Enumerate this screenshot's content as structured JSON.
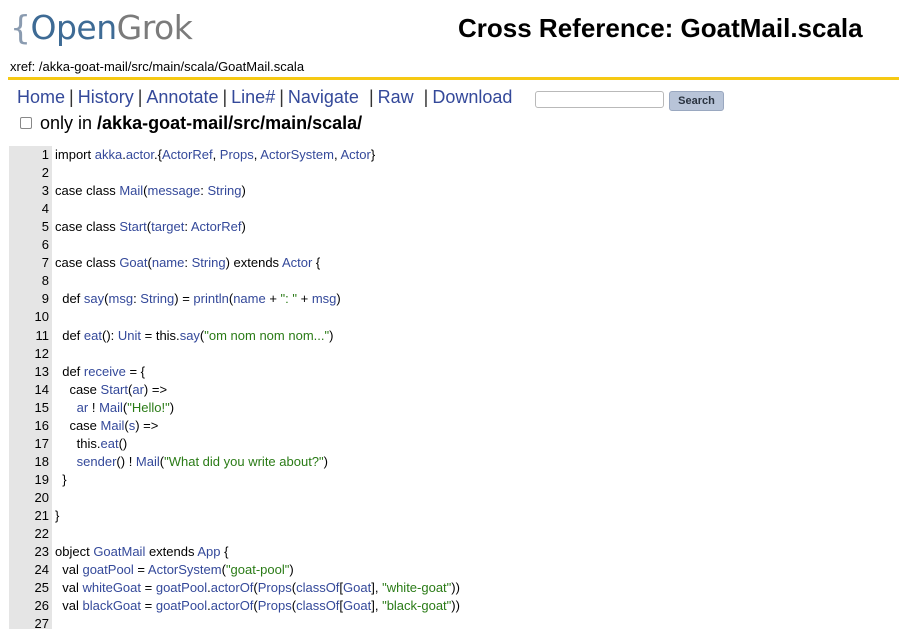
{
  "header": {
    "logo_brace": "{",
    "logo_open": "Open",
    "logo_grok": "Grok",
    "title": "Cross Reference: GoatMail.scala",
    "xref_label": "xref: ",
    "xref_path": "/akka-goat-mail/src/main/scala/GoatMail.scala"
  },
  "nav": {
    "items": [
      "Home",
      "History",
      "Annotate",
      "Line#",
      "Navigate",
      "Raw",
      "Download"
    ],
    "separator": "|",
    "search_placeholder": "",
    "search_value": "",
    "search_button": "Search",
    "only_in_label": "only in ",
    "only_in_path": "/akka-goat-mail/src/main/scala/"
  },
  "code": {
    "lines": [
      {
        "n": "1",
        "text": [
          [
            "k",
            "import "
          ],
          [
            "t",
            "akka"
          ],
          [
            "k",
            "."
          ],
          [
            "t",
            "actor"
          ],
          [
            "k",
            ".{"
          ],
          [
            "t",
            "ActorRef"
          ],
          [
            "k",
            ", "
          ],
          [
            "t",
            "Props"
          ],
          [
            "k",
            ", "
          ],
          [
            "t",
            "ActorSystem"
          ],
          [
            "k",
            ", "
          ],
          [
            "t",
            "Actor"
          ],
          [
            "k",
            "}"
          ]
        ]
      },
      {
        "n": "2",
        "text": []
      },
      {
        "n": "3",
        "text": [
          [
            "k",
            "case class "
          ],
          [
            "t",
            "Mail"
          ],
          [
            "k",
            "("
          ],
          [
            "t",
            "message"
          ],
          [
            "k",
            ": "
          ],
          [
            "t",
            "String"
          ],
          [
            "k",
            ")"
          ]
        ]
      },
      {
        "n": "4",
        "text": []
      },
      {
        "n": "5",
        "text": [
          [
            "k",
            "case class "
          ],
          [
            "t",
            "Start"
          ],
          [
            "k",
            "("
          ],
          [
            "t",
            "target"
          ],
          [
            "k",
            ": "
          ],
          [
            "t",
            "ActorRef"
          ],
          [
            "k",
            ")"
          ]
        ]
      },
      {
        "n": "6",
        "text": []
      },
      {
        "n": "7",
        "text": [
          [
            "k",
            "case class "
          ],
          [
            "t",
            "Goat"
          ],
          [
            "k",
            "("
          ],
          [
            "t",
            "name"
          ],
          [
            "k",
            ": "
          ],
          [
            "t",
            "String"
          ],
          [
            "k",
            ") extends "
          ],
          [
            "t",
            "Actor"
          ],
          [
            "k",
            " {"
          ]
        ]
      },
      {
        "n": "8",
        "text": []
      },
      {
        "n": "9",
        "text": [
          [
            "k",
            "  def "
          ],
          [
            "t",
            "say"
          ],
          [
            "k",
            "("
          ],
          [
            "t",
            "msg"
          ],
          [
            "k",
            ": "
          ],
          [
            "t",
            "String"
          ],
          [
            "k",
            ") = "
          ],
          [
            "t",
            "println"
          ],
          [
            "k",
            "("
          ],
          [
            "t",
            "name"
          ],
          [
            "k",
            " + "
          ],
          [
            "s",
            "\": \""
          ],
          [
            "k",
            " + "
          ],
          [
            "t",
            "msg"
          ],
          [
            "k",
            ")"
          ]
        ]
      },
      {
        "n": "10",
        "text": []
      },
      {
        "n": "11",
        "text": [
          [
            "k",
            "  def "
          ],
          [
            "t",
            "eat"
          ],
          [
            "k",
            "(): "
          ],
          [
            "t",
            "Unit"
          ],
          [
            "k",
            " = this."
          ],
          [
            "t",
            "say"
          ],
          [
            "k",
            "("
          ],
          [
            "s",
            "\"om nom nom nom...\""
          ],
          [
            "k",
            ")"
          ]
        ]
      },
      {
        "n": "12",
        "text": []
      },
      {
        "n": "13",
        "text": [
          [
            "k",
            "  def "
          ],
          [
            "t",
            "receive"
          ],
          [
            "k",
            " = {"
          ]
        ]
      },
      {
        "n": "14",
        "text": [
          [
            "k",
            "    case "
          ],
          [
            "t",
            "Start"
          ],
          [
            "k",
            "("
          ],
          [
            "t",
            "ar"
          ],
          [
            "k",
            ") =>"
          ]
        ]
      },
      {
        "n": "15",
        "text": [
          [
            "k",
            "      "
          ],
          [
            "t",
            "ar"
          ],
          [
            "k",
            " ! "
          ],
          [
            "t",
            "Mail"
          ],
          [
            "k",
            "("
          ],
          [
            "s",
            "\"Hello!\""
          ],
          [
            "k",
            ")"
          ]
        ]
      },
      {
        "n": "16",
        "text": [
          [
            "k",
            "    case "
          ],
          [
            "t",
            "Mail"
          ],
          [
            "k",
            "("
          ],
          [
            "t",
            "s"
          ],
          [
            "k",
            ") =>"
          ]
        ]
      },
      {
        "n": "17",
        "text": [
          [
            "k",
            "      this."
          ],
          [
            "t",
            "eat"
          ],
          [
            "k",
            "()"
          ]
        ]
      },
      {
        "n": "18",
        "text": [
          [
            "k",
            "      "
          ],
          [
            "t",
            "sender"
          ],
          [
            "k",
            "() ! "
          ],
          [
            "t",
            "Mail"
          ],
          [
            "k",
            "("
          ],
          [
            "s",
            "\"What did you write about?\""
          ],
          [
            "k",
            ")"
          ]
        ]
      },
      {
        "n": "19",
        "text": [
          [
            "k",
            "  }"
          ]
        ]
      },
      {
        "n": "20",
        "text": []
      },
      {
        "n": "21",
        "text": [
          [
            "k",
            "}"
          ]
        ]
      },
      {
        "n": "22",
        "text": []
      },
      {
        "n": "23",
        "text": [
          [
            "k",
            "object "
          ],
          [
            "t",
            "GoatMail"
          ],
          [
            "k",
            " extends "
          ],
          [
            "t",
            "App"
          ],
          [
            "k",
            " {"
          ]
        ]
      },
      {
        "n": "24",
        "text": [
          [
            "k",
            "  val "
          ],
          [
            "t",
            "goatPool"
          ],
          [
            "k",
            " = "
          ],
          [
            "t",
            "ActorSystem"
          ],
          [
            "k",
            "("
          ],
          [
            "s",
            "\"goat-pool\""
          ],
          [
            "k",
            ")"
          ]
        ]
      },
      {
        "n": "25",
        "text": [
          [
            "k",
            "  val "
          ],
          [
            "t",
            "whiteGoat"
          ],
          [
            "k",
            " = "
          ],
          [
            "t",
            "goatPool"
          ],
          [
            "k",
            "."
          ],
          [
            "t",
            "actorOf"
          ],
          [
            "k",
            "("
          ],
          [
            "t",
            "Props"
          ],
          [
            "k",
            "("
          ],
          [
            "t",
            "classOf"
          ],
          [
            "k",
            "["
          ],
          [
            "t",
            "Goat"
          ],
          [
            "k",
            "], "
          ],
          [
            "s",
            "\"white-goat\""
          ],
          [
            "k",
            "))"
          ]
        ]
      },
      {
        "n": "26",
        "text": [
          [
            "k",
            "  val "
          ],
          [
            "t",
            "blackGoat"
          ],
          [
            "k",
            " = "
          ],
          [
            "t",
            "goatPool"
          ],
          [
            "k",
            "."
          ],
          [
            "t",
            "actorOf"
          ],
          [
            "k",
            "("
          ],
          [
            "t",
            "Props"
          ],
          [
            "k",
            "("
          ],
          [
            "t",
            "classOf"
          ],
          [
            "k",
            "["
          ],
          [
            "t",
            "Goat"
          ],
          [
            "k",
            "], "
          ],
          [
            "s",
            "\"black-goat\""
          ],
          [
            "k",
            "))"
          ]
        ]
      },
      {
        "n": "27",
        "text": []
      }
    ]
  }
}
